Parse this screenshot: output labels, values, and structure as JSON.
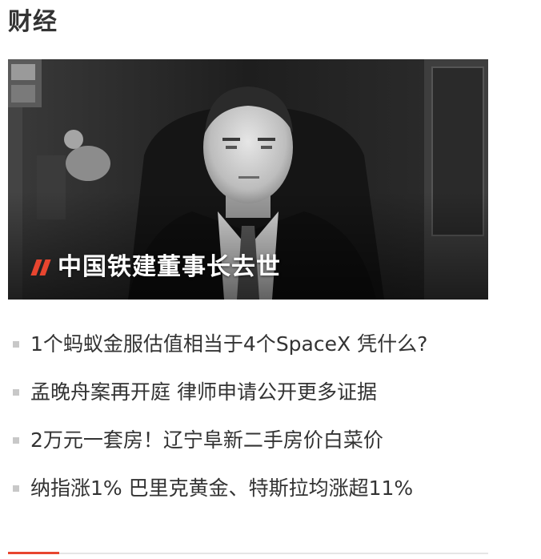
{
  "section": {
    "title": "财经"
  },
  "hero": {
    "caption": "中国铁建董事长去世",
    "icon": "double-slash-icon",
    "accent_color": "#e8452f"
  },
  "news": {
    "items": [
      {
        "label": "1个蚂蚁金服估值相当于4个SpaceX 凭什么?"
      },
      {
        "label": "孟晚舟案再开庭 律师申请公开更多证据"
      },
      {
        "label": "2万元一套房！辽宁阜新二手房价白菜价"
      },
      {
        "label": "纳指涨1% 巴里克黄金、特斯拉均涨超11%"
      }
    ]
  },
  "colors": {
    "text": "#333333",
    "bullet": "#c8c8c8",
    "accent": "#e8452f",
    "divider": "#e5e5e5"
  }
}
